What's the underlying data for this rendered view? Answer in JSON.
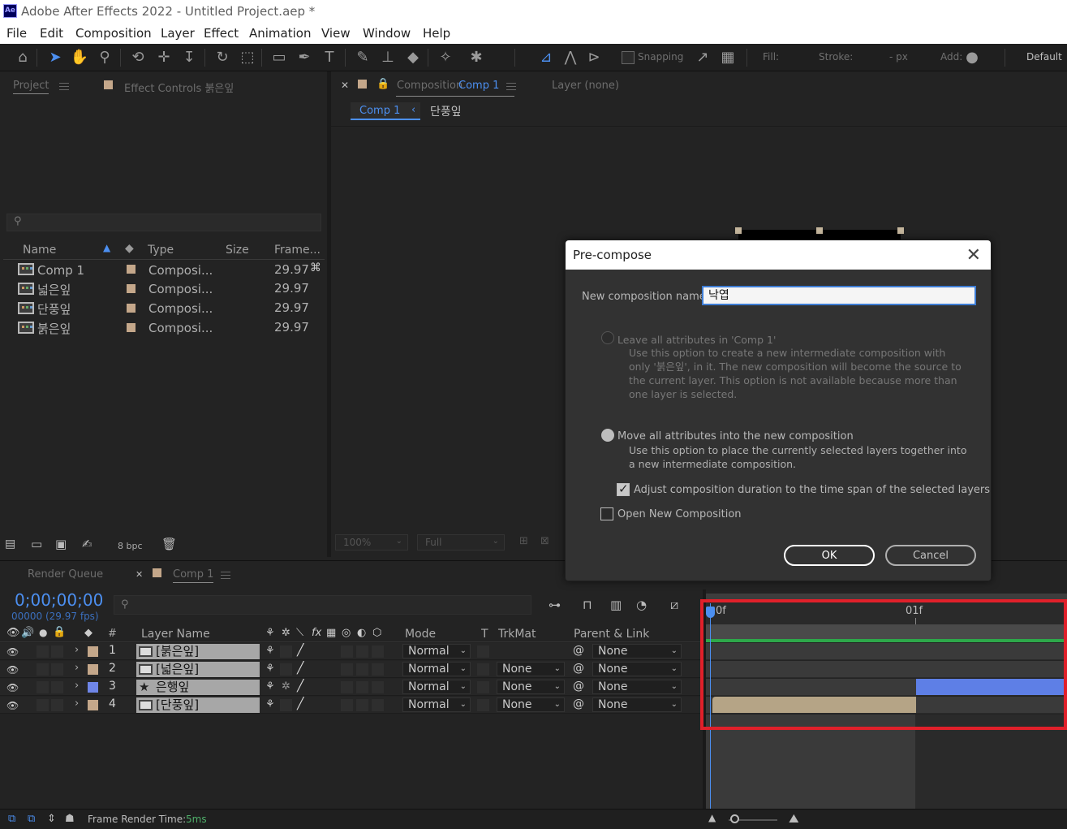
{
  "window": {
    "title": "Adobe After Effects 2022 - Untitled Project.aep *",
    "logo": "Ae"
  },
  "menu": [
    "File",
    "Edit",
    "Composition",
    "Layer",
    "Effect",
    "Animation",
    "View",
    "Window",
    "Help"
  ],
  "toolbar": {
    "snapping_label": "Snapping",
    "fill_label": "Fill:",
    "stroke_label": "Stroke:",
    "px_label": "- px",
    "add_label": "Add:",
    "workspace_label": "Default",
    "fill_color": "#c89a1e",
    "accent_color": "#4c8ff0"
  },
  "project_panel": {
    "tab_project": "Project",
    "tab_effect_controls": "Effect Controls 붉은잎",
    "columns": {
      "name": "Name",
      "type": "Type",
      "size": "Size",
      "frame": "Frame..."
    },
    "items": [
      {
        "name": "Comp 1",
        "type": "Composi...",
        "frame": "29.97"
      },
      {
        "name": "넓은잎",
        "type": "Composi...",
        "frame": "29.97"
      },
      {
        "name": "단풍잎",
        "type": "Composi...",
        "frame": "29.97"
      },
      {
        "name": "붉은잎",
        "type": "Composi...",
        "frame": "29.97"
      }
    ],
    "bpc_label": "8 bpc"
  },
  "comp_panel": {
    "tab_label": "Composition",
    "tab_comp_name": "Comp 1",
    "layer_tab": "Layer (none)",
    "breadcrumb_comp": "Comp 1",
    "breadcrumb_child": "단풍잎",
    "zoom_value": "100%",
    "resolution_value": "Full"
  },
  "dialog": {
    "title": "Pre-compose",
    "name_label": "New composition name:",
    "name_value": "낙엽",
    "option1_label": "Leave all attributes in 'Comp 1'",
    "option1_help": "Use this option to create a new intermediate composition with only '붉은잎', in it. The new composition will become the source to the current layer. This option is not available because more than one layer is selected.",
    "option2_label": "Move all attributes into the new composition",
    "option2_help": "Use this option to place the currently selected layers together into a new intermediate composition.",
    "adjust_label": "Adjust composition duration to the time span of the selected layers",
    "open_label": "Open New Composition",
    "ok_label": "OK",
    "cancel_label": "Cancel"
  },
  "timeline": {
    "tab_render_queue": "Render Queue",
    "tab_comp": "Comp 1",
    "timecode": "0;00;00;00",
    "frame_info": "00000 (29.97 fps)",
    "columns": {
      "num": "#",
      "layer_name": "Layer Name",
      "mode": "Mode",
      "t": "T",
      "trkmat": "TrkMat",
      "parent": "Parent & Link"
    },
    "ruler": {
      "start": "0f",
      "mark": "01f"
    },
    "layers": [
      {
        "num": "1",
        "name": "[붉은잎]",
        "mode": "Normal",
        "trkmat": "",
        "parent": "None",
        "color": "#c4a78a"
      },
      {
        "num": "2",
        "name": "[넓은잎]",
        "mode": "Normal",
        "trkmat": "None",
        "parent": "None",
        "color": "#c4a78a"
      },
      {
        "num": "3",
        "name": "은행잎",
        "mode": "Normal",
        "trkmat": "None",
        "parent": "None",
        "color": "#6f86e8"
      },
      {
        "num": "4",
        "name": "[단풍잎]",
        "mode": "Normal",
        "trkmat": "None",
        "parent": "None",
        "color": "#c4a78a"
      }
    ],
    "status_label": "Frame Render Time:",
    "status_value": "5ms",
    "highlight_color": "#e0202a"
  }
}
